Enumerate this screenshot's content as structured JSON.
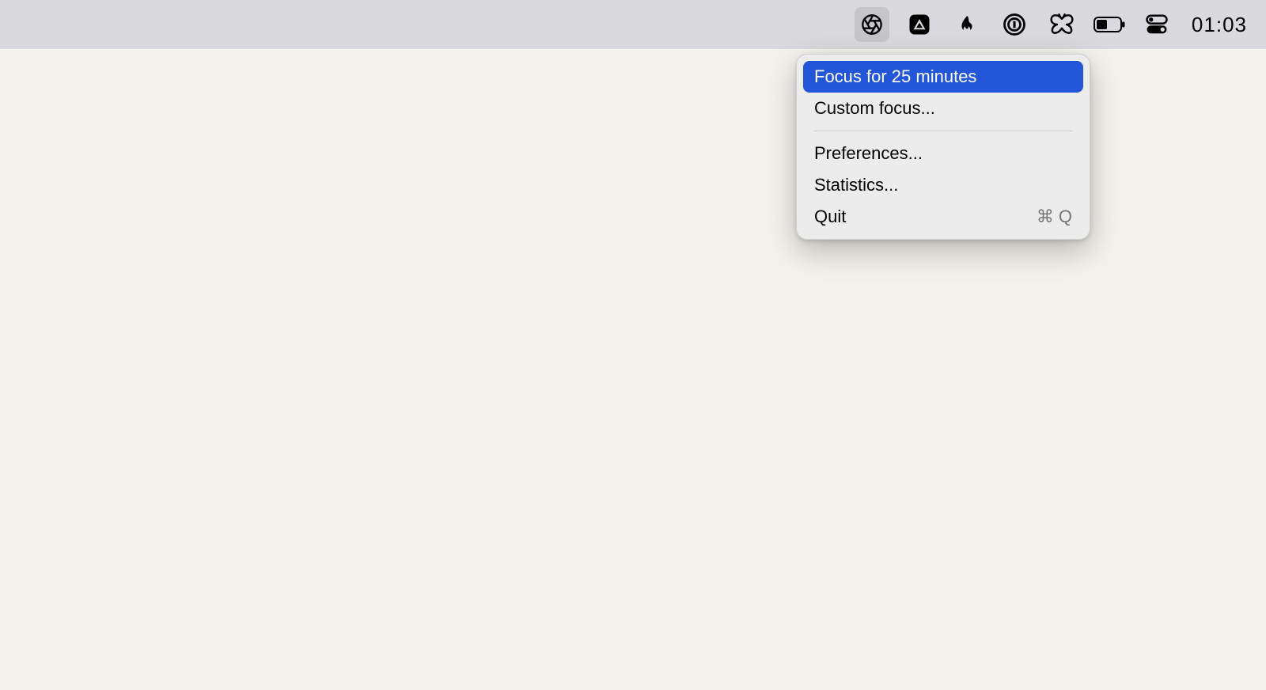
{
  "menubar": {
    "icons": [
      {
        "name": "aperture-icon",
        "active": true
      },
      {
        "name": "triangle-icon",
        "active": false
      },
      {
        "name": "flame-icon",
        "active": false
      },
      {
        "name": "onepassword-icon",
        "active": false
      },
      {
        "name": "butterfly-icon",
        "active": false
      },
      {
        "name": "battery-icon",
        "active": false
      },
      {
        "name": "control-center-icon",
        "active": false
      }
    ],
    "clock": "01:03"
  },
  "dropdown": {
    "items": [
      {
        "id": "focus-25",
        "label": "Focus for 25 minutes",
        "type": "item",
        "highlight": true
      },
      {
        "id": "custom-focus",
        "label": "Custom focus...",
        "type": "item",
        "highlight": false
      },
      {
        "type": "separator"
      },
      {
        "id": "preferences",
        "label": "Preferences...",
        "type": "item",
        "highlight": false
      },
      {
        "id": "statistics",
        "label": "Statistics...",
        "type": "item",
        "highlight": false
      },
      {
        "id": "quit",
        "label": "Quit",
        "type": "item",
        "highlight": false,
        "shortcut": {
          "symbol": "⌘",
          "key": "Q"
        }
      }
    ]
  }
}
